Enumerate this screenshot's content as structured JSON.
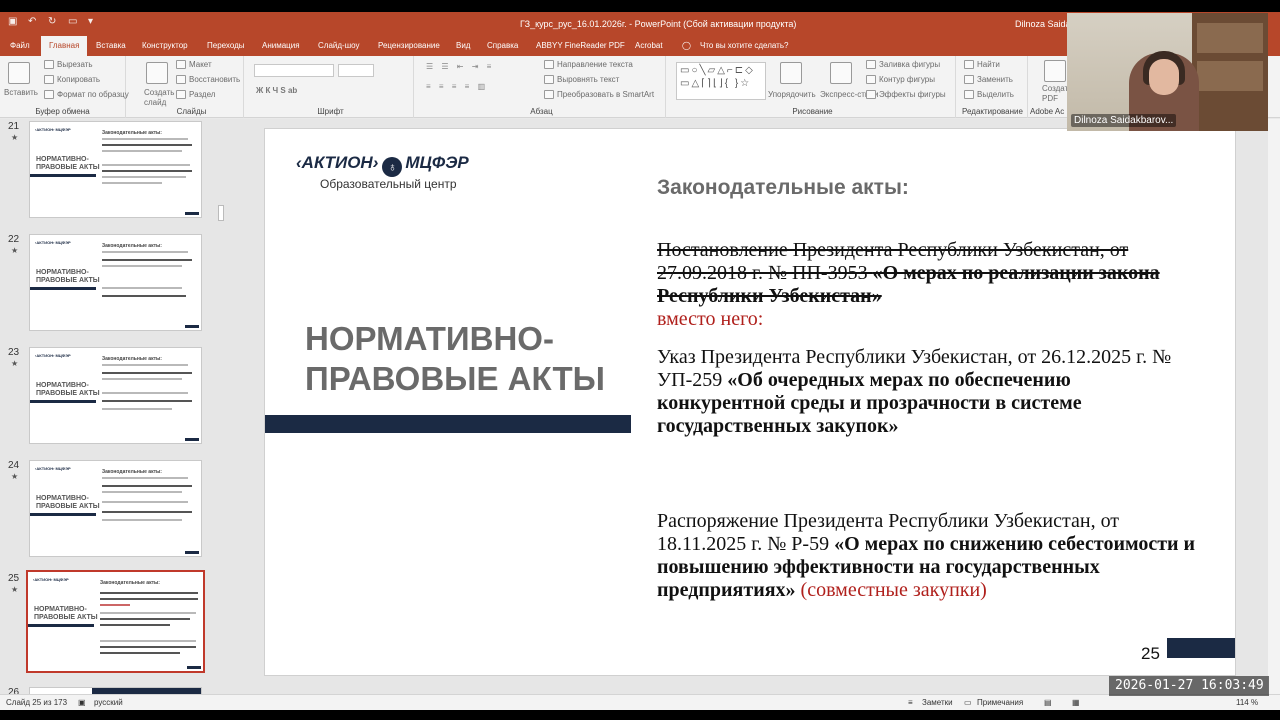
{
  "window": {
    "title": "ГЗ_курс_рус_16.01.2026г. - PowerPoint (Сбой активации продукта)",
    "user": "Dilnoza Saidakbarovna"
  },
  "tabs": [
    "Файл",
    "Главная",
    "Вставка",
    "Конструктор",
    "Переходы",
    "Анимация",
    "Слайд-шоу",
    "Рецензирование",
    "Вид",
    "Справка",
    "ABBYY FineReader PDF",
    "Acrobat"
  ],
  "tell_me": "Что вы хотите сделать?",
  "ribbon": {
    "clipboard": {
      "paste": "Вставить",
      "cut": "Вырезать",
      "copy": "Копировать",
      "format_painter": "Формат по образцу",
      "label": "Буфер обмена"
    },
    "slides": {
      "new_slide": "Создать слайд",
      "layout": "Макет",
      "reset": "Восстановить",
      "section": "Раздел",
      "label": "Слайды"
    },
    "font": {
      "label": "Шрифт"
    },
    "paragraph": {
      "text_direction": "Направление текста",
      "align_text": "Выровнять текст",
      "smartart": "Преобразовать в SmartArt",
      "label": "Абзац"
    },
    "drawing": {
      "arrange": "Упорядочить",
      "quick_styles": "Экспресс-стили",
      "fill": "Заливка фигуры",
      "outline": "Контур фигуры",
      "effects": "Эффекты фигуры",
      "label": "Рисование"
    },
    "editing": {
      "find": "Найти",
      "replace": "Заменить",
      "select": "Выделить",
      "label": "Редактирование"
    },
    "adobe": {
      "create_pdf": "Создать PDF",
      "label": "Adobe Ac"
    }
  },
  "thumbnails": [
    {
      "num": "21",
      "head": "Законодательные акты:"
    },
    {
      "num": "22",
      "head": "Законодательные акты:"
    },
    {
      "num": "23",
      "head": "Законодательные акты:"
    },
    {
      "num": "24",
      "head": "Законодательные акты:"
    },
    {
      "num": "25",
      "head": "Законодательные акты:"
    },
    {
      "num": "26",
      "head": ""
    }
  ],
  "thumb_title_line1": "НОРМАТИВНО-",
  "thumb_title_line2": "ПРАВОВЫЕ АКТЫ",
  "slide": {
    "logo_main_left": "‹АКТИОН›",
    "logo_main_right": "МЦФЭР",
    "logo_sub": "Образовательный центр",
    "title_line1": "НОРМАТИВНО-",
    "title_line2": "ПРАВОВЫЕ АКТЫ",
    "section_title": "Законодательные акты:",
    "p1_strike_plain": "Постановление Президента Республики Узбекистан, от 27.09.2018 г. № ПП-3953 ",
    "p1_strike_bold": "«О мерах по реализации закона Республики Узбекистан»",
    "p1_instead": "вместо него:",
    "p2_plain": "Указ Президента Республики Узбекистан, от 26.12.2025 г. № УП-259 ",
    "p2_bold": "«Об очередных мерах по обеспечению конкурентной среды и прозрачности в системе государственных закупок»",
    "p3_plain": "Распоряжение Президента Республики Узбекистан, от 18.11.2025 г. № Р-59 ",
    "p3_bold": "«О мерах по снижению себестоимости и повышению эффективности на государственных предприятиях»",
    "p3_red": " (совместные закупки)",
    "number": "25"
  },
  "status": {
    "slide_of": "Слайд 25 из 173",
    "language": "русский",
    "notes": "Заметки",
    "comments": "Примечания",
    "zoom": "114 %"
  },
  "webcam": {
    "name": "Dilnoza Saidakbarov..."
  },
  "timestamp": "2026-01-27  16:03:49",
  "colors": {
    "accent": "#b7472a",
    "navy": "#1b2a44",
    "red_text": "#b0201c"
  }
}
